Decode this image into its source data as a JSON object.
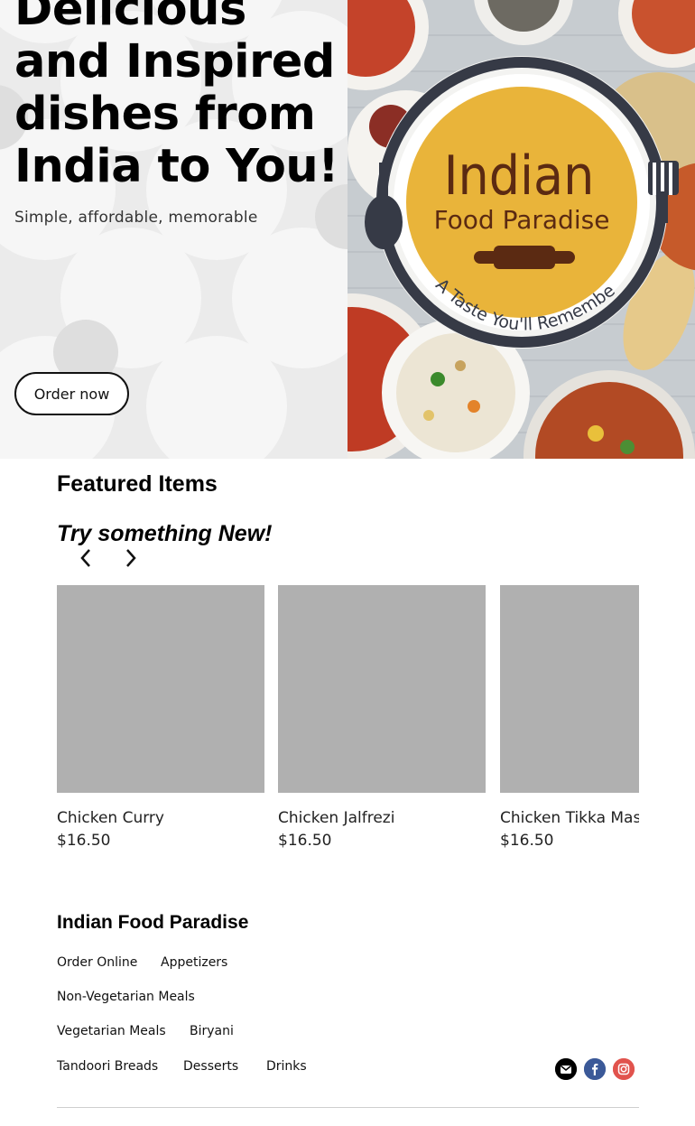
{
  "hero": {
    "title": "Delicious and Inspired dishes from India to You!",
    "subtitle": "Simple, affordable, memorable",
    "cta_label": "Order now",
    "logo": {
      "line1": "Indian",
      "line2": "Food Paradise",
      "tagline": "A Taste You'll Remember"
    }
  },
  "featured": {
    "title": "Featured Items",
    "subtitle": "Try something New!",
    "prev_icon": "chevron-left-icon",
    "next_icon": "chevron-right-icon",
    "items": [
      {
        "name": "Chicken Curry",
        "price": "$16.50"
      },
      {
        "name": "Chicken Jalfrezi",
        "price": "$16.50"
      },
      {
        "name": "Chicken Tikka Masala",
        "price": "$16.50"
      }
    ]
  },
  "footer": {
    "brand": "Indian Food Paradise",
    "links": [
      "Order Online",
      "Appetizers",
      "Non-Vegetarian Meals",
      "Vegetarian Meals",
      "Biryani",
      "Tandoori Breads",
      "Desserts",
      "Drinks"
    ],
    "social": [
      "email-icon",
      "facebook-icon",
      "instagram-icon"
    ]
  },
  "colors": {
    "logo_gold": "#e9b43a",
    "logo_ring": "#363a46",
    "logo_text": "#5b2a12",
    "facebook": "#3b5998",
    "instagram": "#e1534d"
  }
}
